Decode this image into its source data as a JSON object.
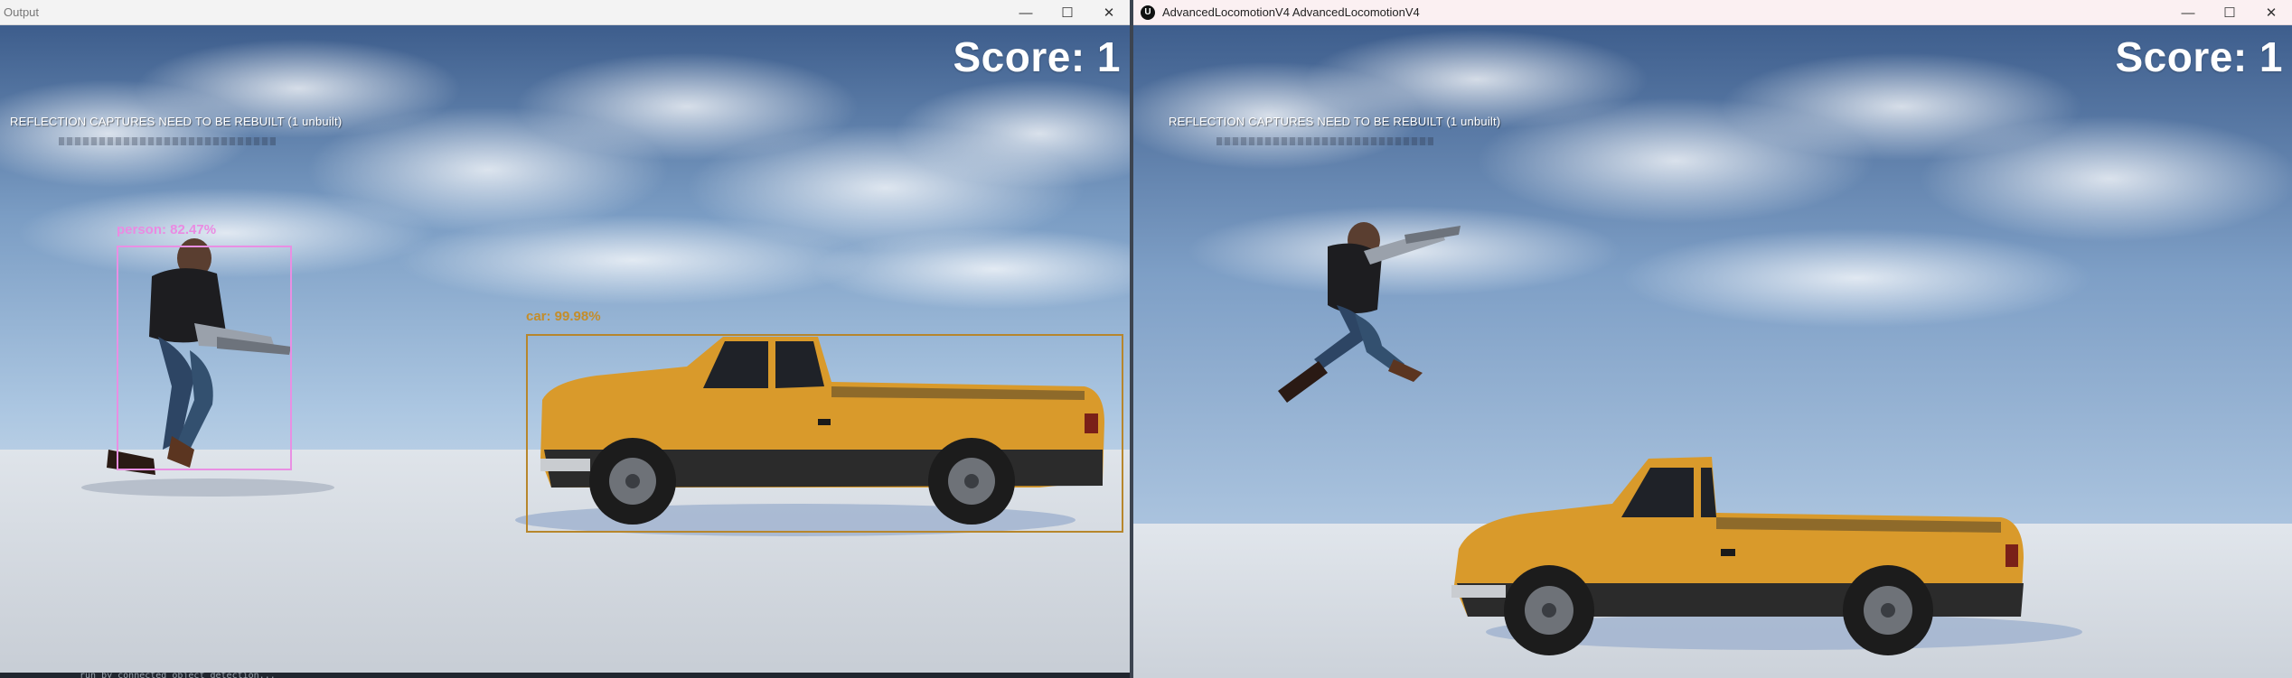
{
  "left_window": {
    "title": "Output",
    "controls": {
      "minimize": "—",
      "maximize": "☐",
      "close": "✕"
    },
    "score": "Score: 1",
    "reflection_warning": "REFLECTION CAPTURES NEED TO BE REBUILT (1 unbuilt)",
    "detections": [
      {
        "label": "person: 82.47%",
        "color": "#e98fe3"
      },
      {
        "label": "car: 99.98%",
        "color": "#b7862c"
      }
    ],
    "console_snippet": "run by connected object detection..."
  },
  "right_window": {
    "title": "AdvancedLocomotionV4 AdvancedLocomotionV4",
    "controls": {
      "minimize": "—",
      "maximize": "☐",
      "close": "✕"
    },
    "score": "Score: 1",
    "reflection_warning": "REFLECTION CAPTURES NEED TO BE REBUILT (1 unbuilt)"
  },
  "icons": {
    "app": "unreal-engine-icon"
  },
  "colors": {
    "sky_top": "#3f5f8e",
    "sky_horizon": "#a9c3df",
    "ground": "#d8dde4",
    "truck_body": "#d99a2b",
    "truck_trim": "#2a2a2a"
  }
}
